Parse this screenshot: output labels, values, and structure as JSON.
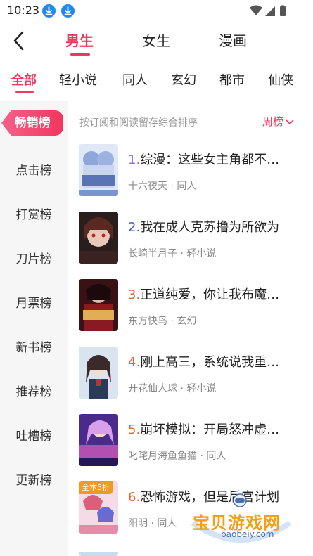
{
  "status_bar": {
    "time": "10:23"
  },
  "gender_tabs": [
    {
      "label": "男生",
      "active": true
    },
    {
      "label": "女生",
      "active": false
    },
    {
      "label": "漫画",
      "active": false
    }
  ],
  "category_tabs": [
    {
      "label": "全部",
      "active": true
    },
    {
      "label": "轻小说",
      "active": false
    },
    {
      "label": "同人",
      "active": false
    },
    {
      "label": "玄幻",
      "active": false
    },
    {
      "label": "都市",
      "active": false
    },
    {
      "label": "仙侠",
      "active": false
    }
  ],
  "sidebar": {
    "items": [
      {
        "label": "畅销榜",
        "active": true
      },
      {
        "label": "点击榜",
        "active": false
      },
      {
        "label": "打赏榜",
        "active": false
      },
      {
        "label": "刀片榜",
        "active": false
      },
      {
        "label": "月票榜",
        "active": false
      },
      {
        "label": "新书榜",
        "active": false
      },
      {
        "label": "推荐榜",
        "active": false
      },
      {
        "label": "吐槽榜",
        "active": false
      },
      {
        "label": "更新榜",
        "active": false
      }
    ]
  },
  "list": {
    "sort_note": "按订阅和阅读留存综合排序",
    "period": "周榜",
    "books": [
      {
        "rank": "1.",
        "title": "综漫：这些女主角都不…",
        "meta": "十六夜天 · 同人",
        "tag": ""
      },
      {
        "rank": "2.",
        "title": "我在成人克苏撸为所欲为",
        "meta": "长崎半月子 · 轻小说",
        "tag": ""
      },
      {
        "rank": "3.",
        "title": "正道纯爱，你让我布魔…",
        "meta": "东方快鸟 · 玄幻",
        "tag": ""
      },
      {
        "rank": "4.",
        "title": "刚上高三，系统说我重…",
        "meta": "开花仙人球 · 轻小说",
        "tag": ""
      },
      {
        "rank": "5.",
        "title": "崩坏模拟：开局怒冲虚…",
        "meta": "叱咤月海鱼鱼猫 · 同人",
        "tag": ""
      },
      {
        "rank": "6.",
        "title": "恐怖游戏，但是后宫计划",
        "meta": "阳明 · 同人",
        "tag": "全本5折"
      }
    ]
  },
  "watermark": {
    "text": "宝贝游戏网",
    "url": "baobeiy.com"
  },
  "colors": {
    "accent": "#f2365d",
    "sidebar_bg": "#f6f6f6"
  }
}
